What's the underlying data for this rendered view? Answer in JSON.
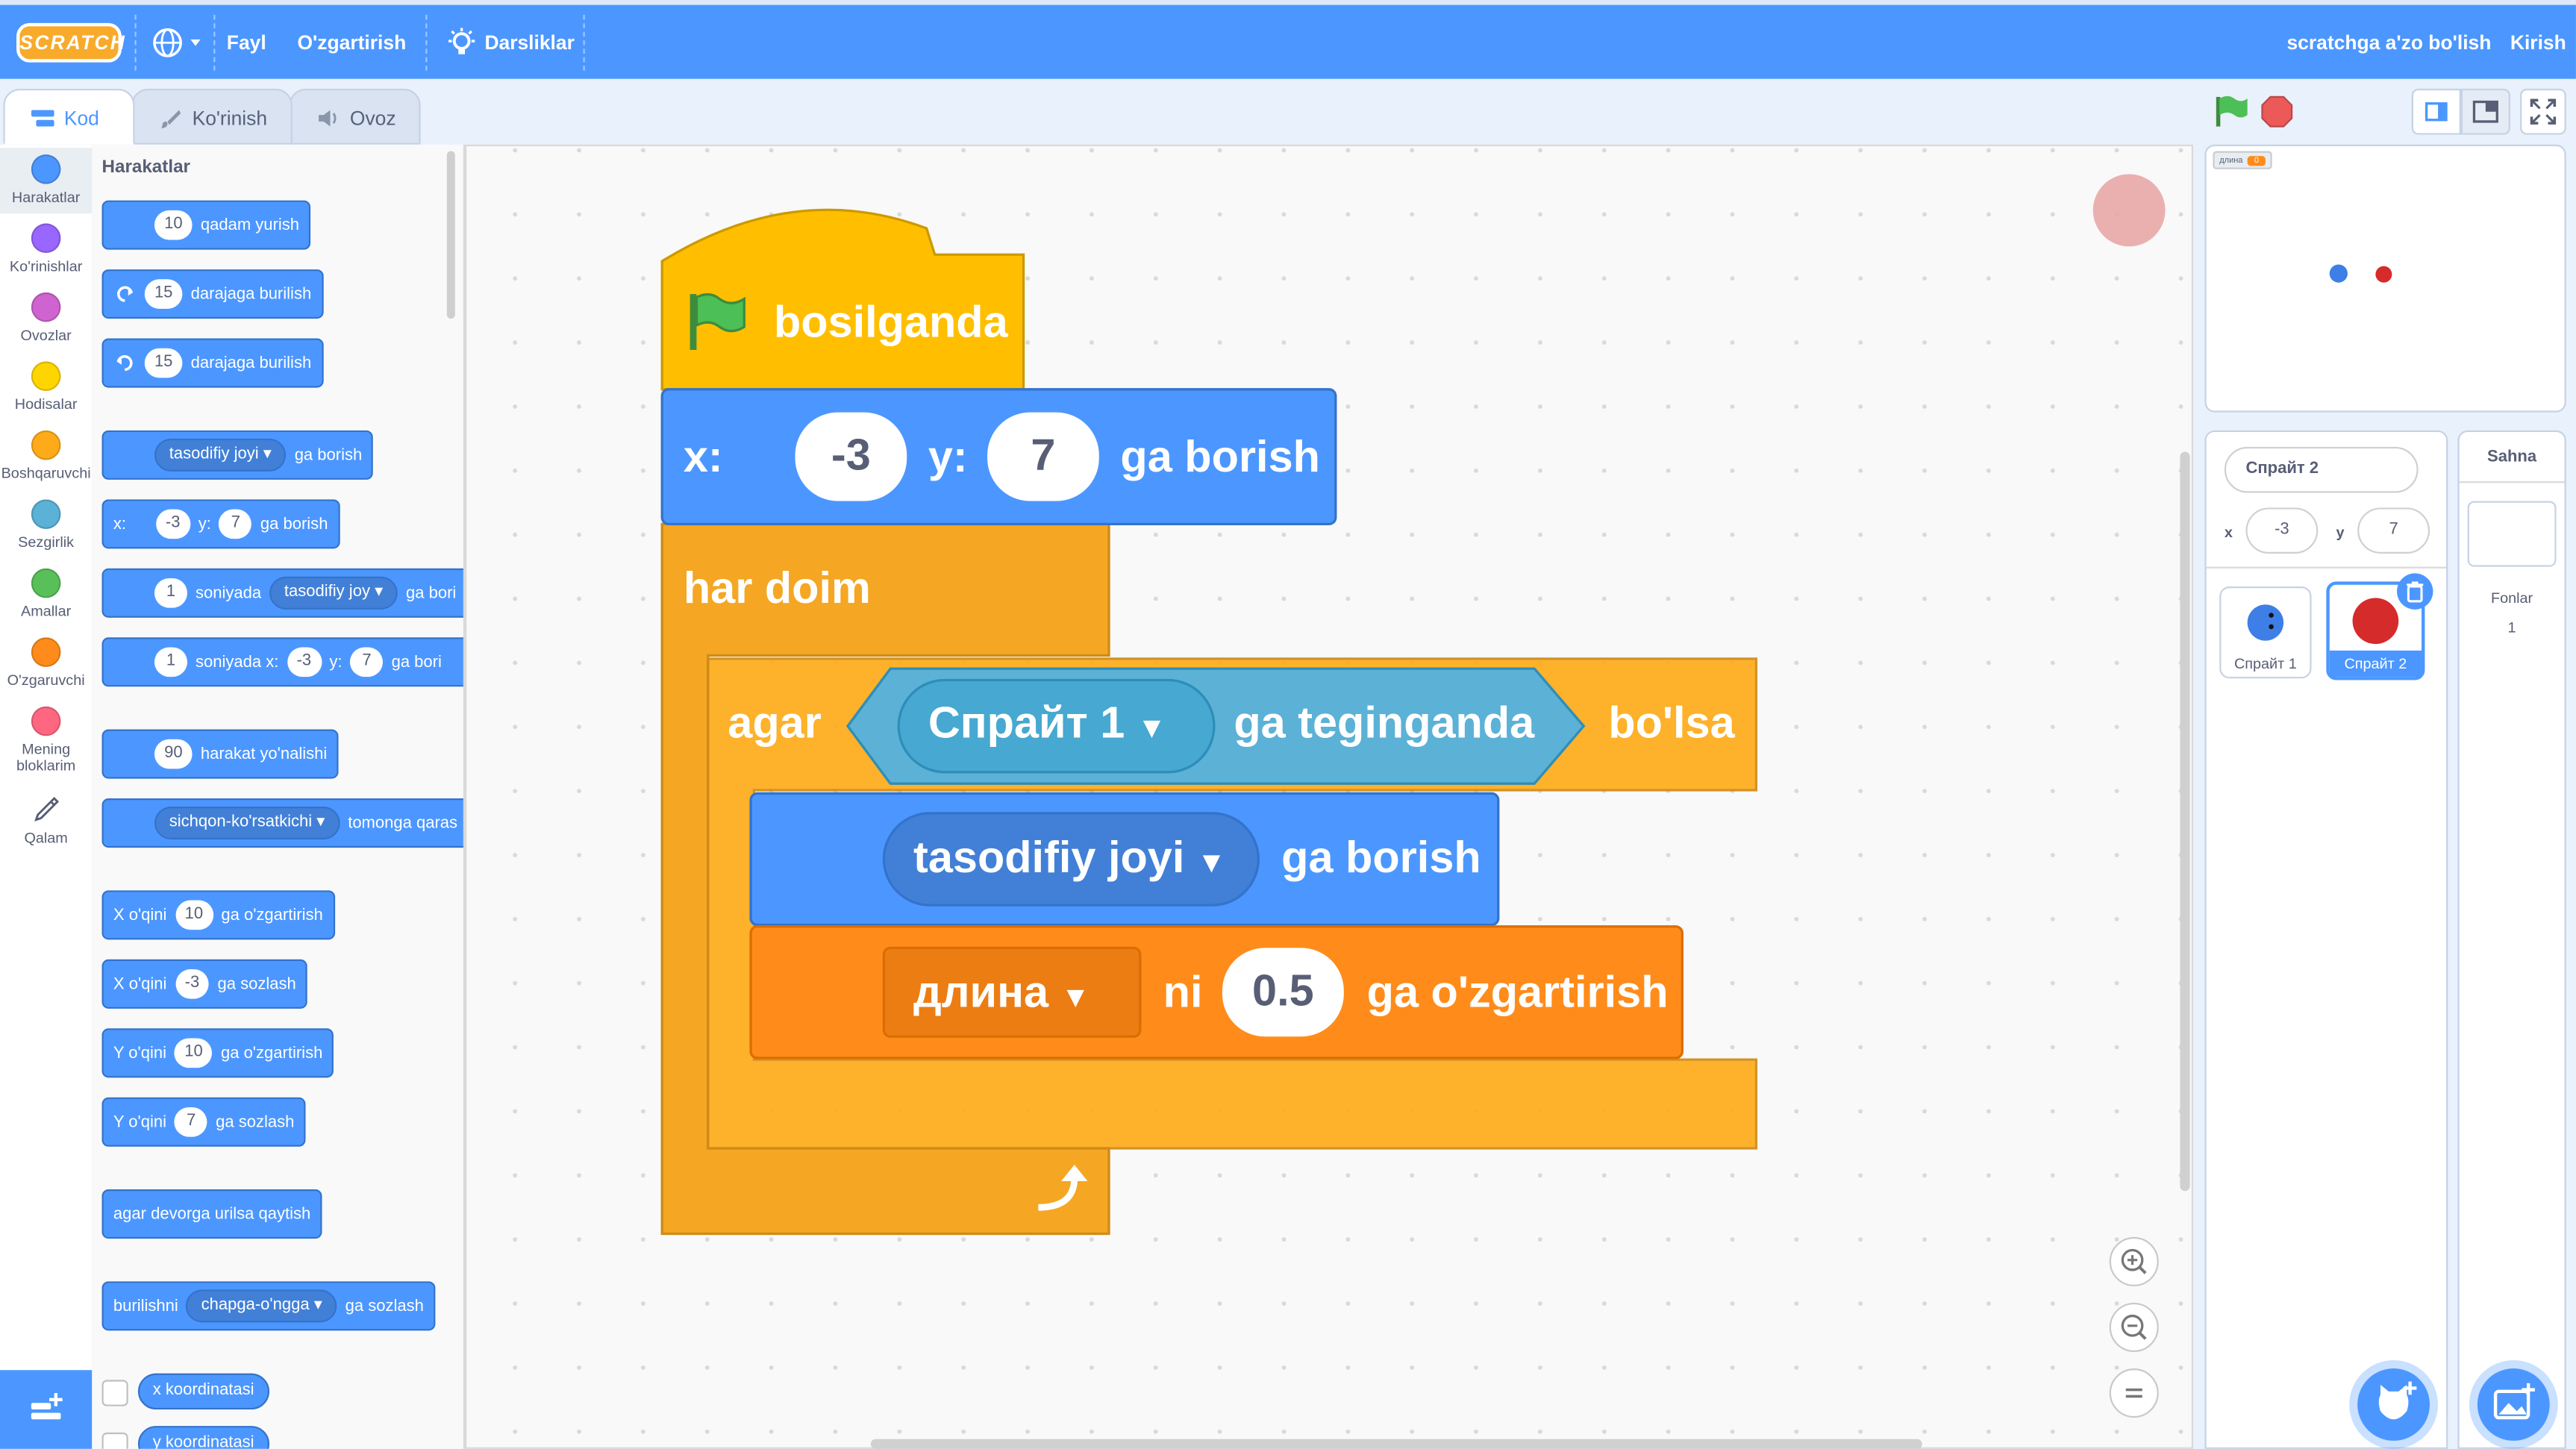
{
  "menu": {
    "logo": "SCRATCH",
    "language_icon": "globe-icon",
    "file": "Fayl",
    "edit": "O'zgartirish",
    "tutorials": "Darsliklar",
    "join": "scratchga a'zo bo'lish",
    "signin": "Kirish"
  },
  "tabs": {
    "code": "Kod",
    "costumes": "Ko'rinish",
    "sounds": "Ovoz"
  },
  "categories": [
    {
      "label": "Harakatlar",
      "color": "#4c97ff"
    },
    {
      "label": "Ko'rinishlar",
      "color": "#9966ff"
    },
    {
      "label": "Ovozlar",
      "color": "#cf63cf"
    },
    {
      "label": "Hodisalar",
      "color": "#ffd500"
    },
    {
      "label": "Boshqaruvchi",
      "color": "#ffab19"
    },
    {
      "label": "Sezgirlik",
      "color": "#5cb1d6"
    },
    {
      "label": "Amallar",
      "color": "#59c059"
    },
    {
      "label": "O'zgaruvchi",
      "color": "#ff8c1a"
    },
    {
      "label": "Mening bloklarim",
      "color": "#ff6680"
    },
    {
      "label": "Qalam",
      "color": "#0fbd8c"
    }
  ],
  "palette": {
    "title": "Harakatlar",
    "move": {
      "val": "10",
      "text": "qadam yurish"
    },
    "turn_right": {
      "val": "15",
      "text": "darajaga burilish"
    },
    "turn_left": {
      "val": "15",
      "text": "darajaga burilish"
    },
    "goto": {
      "dd": "tasodifiy joyi",
      "text": "ga borish"
    },
    "gotoxy": {
      "x_label": "x:",
      "x": "-3",
      "y_label": "y:",
      "y": "7",
      "text": "ga borish"
    },
    "glide": {
      "val": "1",
      "text": "soniyada",
      "dd": "tasodifiy joy",
      "text2": "ga bori"
    },
    "glidexy": {
      "val": "1",
      "text": "soniyada x:",
      "x": "-3",
      "y_label": "y:",
      "y": "7",
      "text2": "ga bori"
    },
    "point_dir": {
      "val": "90",
      "text": "harakat yo'nalishi"
    },
    "point_towards": {
      "dd": "sichqon-ko'rsatkichi",
      "text": "tomonga qaras"
    },
    "change_x": {
      "text": "X o'qini",
      "val": "10",
      "text2": "ga o'zgartirish"
    },
    "set_x": {
      "text": "X o'qini",
      "val": "-3",
      "text2": "ga sozlash"
    },
    "change_y": {
      "text": "Y o'qini",
      "val": "10",
      "text2": "ga o'zgartirish"
    },
    "set_y": {
      "text": "Y o'qini",
      "val": "7",
      "text2": "ga sozlash"
    },
    "bounce": {
      "text": "agar devorga urilsa qaytish"
    },
    "rotation": {
      "text": "burilishni",
      "dd": "chapga-o'ngga",
      "text2": "ga sozlash"
    },
    "xpos": "x koordinatasi",
    "ypos": "y koordinatasi"
  },
  "script": {
    "hat": "bosilganda",
    "goto_x_label": "x:",
    "goto_x": "-3",
    "goto_y_label": "y:",
    "goto_y": "7",
    "goto_text": "ga borish",
    "forever": "har doim",
    "if_label": "agar",
    "touching_dd": "Спрайт 1",
    "touching_text": "ga teginganda",
    "if_then": "bo'lsa",
    "goto_random_dd": "tasodifiy joyi",
    "goto_random_text": "ga borish",
    "var_dd": "длина",
    "var_ni": "ni",
    "var_val": "0.5",
    "var_text": "ga o'zgartirish"
  },
  "stage": {
    "monitor_label": "длина",
    "monitor_value": "0"
  },
  "sprite_info": {
    "name": "Спрайт 2",
    "x_label": "x",
    "x": "-3",
    "y_label": "y",
    "y": "7"
  },
  "sprites": [
    "Спрайт 1",
    "Спрайт 2"
  ],
  "stage_panel": {
    "title": "Sahna",
    "backdrops_label": "Fonlar",
    "backdrops_count": "1"
  },
  "colors": {
    "motion": "#4c97ff",
    "control": "#ffab19",
    "events": "#ffbf00",
    "sensing": "#5cb1d6",
    "variables": "#ff8c1a",
    "menubar": "#4c97ff"
  }
}
